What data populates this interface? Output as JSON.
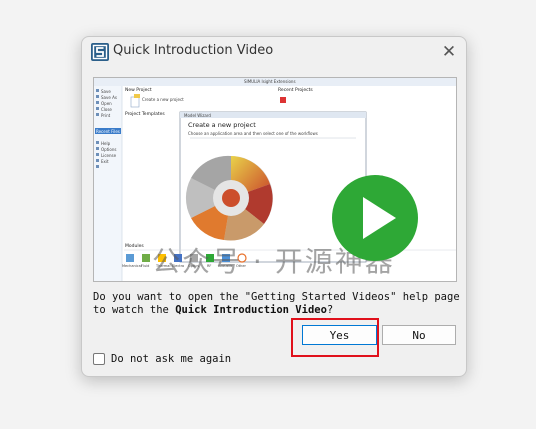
{
  "dialog": {
    "title": "Quick Introduction Video",
    "close_glyph": "✕",
    "message_line1": "Do you want to open the \"Getting Started Videos\" help page",
    "message_line2_prefix": "to watch the ",
    "message_line2_bold": "Quick Introduction Video",
    "message_line2_suffix": "?",
    "yes_label": "Yes",
    "no_label": "No",
    "checkbox_label": "Do not ask me again",
    "checkbox_checked": false,
    "highlight_color": "#e0101b"
  },
  "preview": {
    "play_color": "#2ea836",
    "watermark": "公众号 · 开源神器",
    "app_window_title": "SIMULIA Isight Extensions",
    "sidebar_items": [
      "Save",
      "Save As",
      "Open",
      "Close",
      "Print",
      "Recent Files",
      "Help",
      "Options",
      "License",
      "Exit"
    ],
    "new_project_heading": "New Project",
    "new_project_item": "Create a new project",
    "recent_projects_heading": "Recent Projects",
    "project_templates_heading": "Project Templates",
    "modules_heading": "Modules",
    "module_labels": [
      "Mechanical",
      "Fluid",
      "Thermal",
      "Electro",
      "Optics",
      "RF",
      "Acoustic",
      "Other"
    ],
    "wizard_window_title": "Model Wizard",
    "wizard_heading": "Create a new project",
    "wizard_subheading": "Choose an application area and then select one of the workflows"
  }
}
